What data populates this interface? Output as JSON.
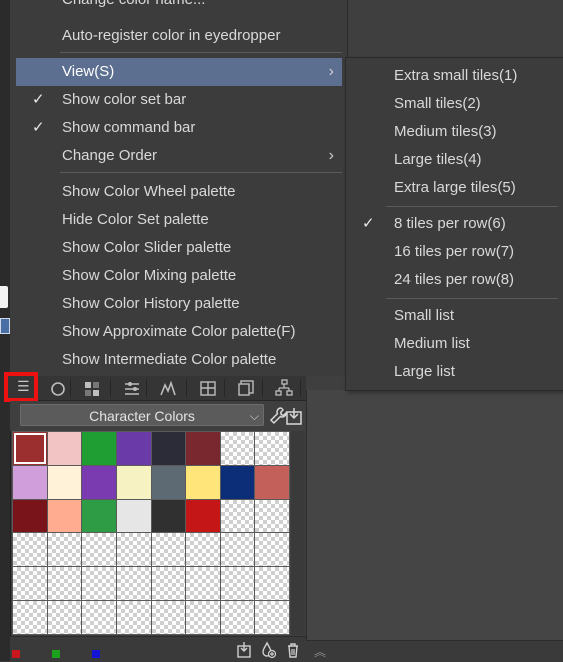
{
  "menu": {
    "items": [
      {
        "label": "Change color name...",
        "checked": false,
        "submenu": false
      },
      {
        "label": "Auto-register color in eyedropper",
        "checked": false,
        "submenu": false
      },
      {
        "label": "View(S)",
        "checked": false,
        "submenu": true,
        "active": true
      },
      {
        "label": "Show color set bar",
        "checked": true,
        "submenu": false
      },
      {
        "label": "Show command bar",
        "checked": true,
        "submenu": false
      },
      {
        "label": "Change Order",
        "checked": false,
        "submenu": true
      },
      {
        "label": "Show Color Wheel palette",
        "checked": false,
        "submenu": false
      },
      {
        "label": "Hide Color Set palette",
        "checked": false,
        "submenu": false
      },
      {
        "label": "Show Color Slider palette",
        "checked": false,
        "submenu": false
      },
      {
        "label": "Show Color Mixing palette",
        "checked": false,
        "submenu": false
      },
      {
        "label": "Show Color History palette",
        "checked": false,
        "submenu": false
      },
      {
        "label": "Show Approximate Color palette(F)",
        "checked": false,
        "submenu": false
      },
      {
        "label": "Show Intermediate Color palette",
        "checked": false,
        "submenu": false
      }
    ],
    "check_glyph": "✓",
    "submenu_arrow": "›"
  },
  "view_submenu": {
    "items": [
      {
        "label": "Extra small tiles(1)",
        "checked": false
      },
      {
        "label": "Small tiles(2)",
        "checked": false
      },
      {
        "label": "Medium tiles(3)",
        "checked": false
      },
      {
        "label": "Large tiles(4)",
        "checked": false
      },
      {
        "label": "Extra large tiles(5)",
        "checked": false
      },
      {
        "label": "8 tiles per row(6)",
        "checked": true
      },
      {
        "label": "16 tiles per row(7)",
        "checked": false
      },
      {
        "label": "24 tiles per row(8)",
        "checked": false
      },
      {
        "label": "Small list",
        "checked": false
      },
      {
        "label": "Medium list",
        "checked": false
      },
      {
        "label": "Large list",
        "checked": false
      }
    ]
  },
  "palette": {
    "menu_icon": "hamburger-menu-icon",
    "tabs": [
      "color-wheel-icon",
      "color-set-icon",
      "color-slider-icon",
      "approximate-color-icon",
      "intermediate-color-icon",
      "color-history-icon",
      "mixing-icon",
      "layer-tree-icon"
    ],
    "set_name": "Character Colors",
    "tools": [
      "wrench-icon",
      "import-icon"
    ],
    "colors": [
      "#9b2e2e",
      "#f2c4c4",
      "#1e9e33",
      "#6a3aa8",
      "#2c2c38",
      "#7a2830",
      null,
      null,
      "#cf9edb",
      "#fff2d9",
      "#7a3ab0",
      "#f6f2c2",
      "#5e6a73",
      "#ffe57a",
      "#0c2e78",
      "#c4605a",
      "#7a141b",
      "#ffac90",
      "#2e9c45",
      "#e6e6e6",
      "#303030",
      "#c41616",
      null,
      null,
      null,
      null,
      null,
      null,
      null,
      null,
      null,
      null,
      null,
      null,
      null,
      null,
      null,
      null,
      null,
      null,
      null,
      null,
      null,
      null,
      null,
      null,
      null,
      null
    ],
    "selected_index": 0,
    "bottom_swatches": [
      "#c8181e",
      "#1da21d",
      "#1414d2"
    ],
    "bottom_tools": [
      "import-set-icon",
      "add-color-icon",
      "delete-color-icon"
    ]
  },
  "right_panel": {
    "collapse_glyph": "︽"
  }
}
